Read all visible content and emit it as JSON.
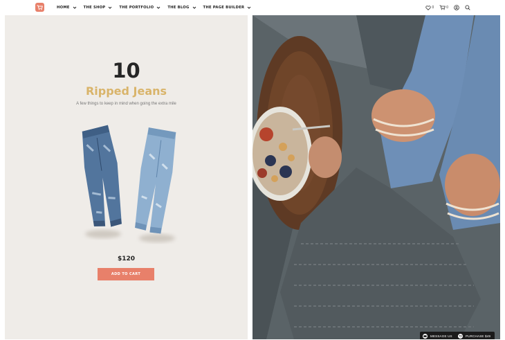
{
  "header": {
    "nav": [
      {
        "label": "HOME"
      },
      {
        "label": "THE SHOP"
      },
      {
        "label": "THE PORTFOLIO"
      },
      {
        "label": "THE BLOG"
      },
      {
        "label": "THE PAGE BUILDER"
      }
    ],
    "wishlist_count": "0",
    "cart_count": "0",
    "icons": [
      "cart-logo-icon",
      "heart-icon",
      "cart-icon",
      "user-icon",
      "search-icon"
    ]
  },
  "product": {
    "number": "10",
    "title": "Ripped Jeans",
    "subtitle": "A few things to keep in mind when going the extra mile",
    "price": "$120",
    "cta": "ADD TO CART"
  },
  "floating": {
    "message": "MESSAGE US",
    "purchase": "PURCHASE $49"
  },
  "colors": {
    "accent": "#e8806a",
    "title_gold": "#d9b46a",
    "panel_bg": "#efece8",
    "text_dark": "#262626"
  }
}
